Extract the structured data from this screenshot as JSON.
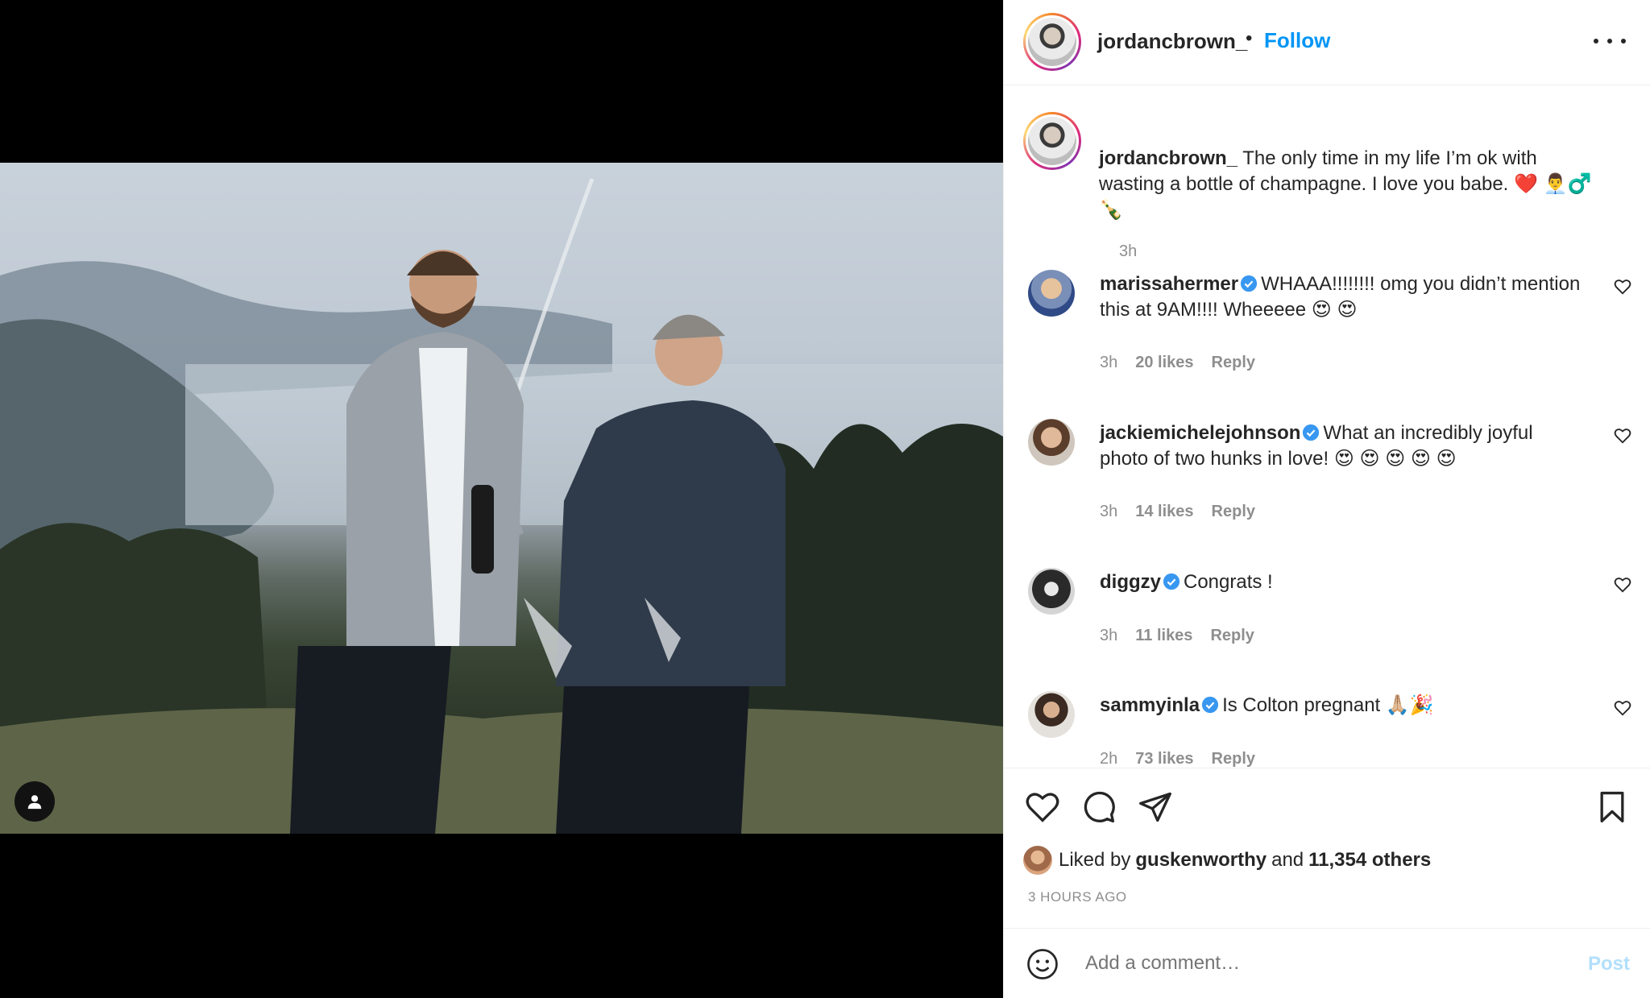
{
  "post": {
    "username": "jordancbrown_",
    "separator": "•",
    "follow_label": "Follow",
    "more_icon": "more-horizontal-icon"
  },
  "caption": {
    "username": "jordancbrown_",
    "text": "The only time in my life I’m ok with wasting a bottle of champagne. I love you babe. ❤️ 👨‍💼♂️ 🍾",
    "time": "3h"
  },
  "comments": [
    {
      "username": "marissahermer",
      "verified": true,
      "text": "WHAAA!!!!!!!! omg you didn’t mention this at 9AM!!!! Wheeeee 😍 😍",
      "time": "3h",
      "likes": "20 likes",
      "reply": "Reply"
    },
    {
      "username": "jackiemichelejohnson",
      "verified": true,
      "text": "What an incredibly joyful photo of two hunks in love! 😍 😍 😍 😍 😍",
      "time": "3h",
      "likes": "14 likes",
      "reply": "Reply"
    },
    {
      "username": "diggzy",
      "verified": true,
      "text": "Congrats !",
      "time": "3h",
      "likes": "11 likes",
      "reply": "Reply"
    },
    {
      "username": "sammyinla",
      "verified": true,
      "text": "Is Colton pregnant 🙏🏼🎉",
      "time": "2h",
      "likes": "73 likes",
      "reply": "Reply"
    }
  ],
  "likes": {
    "prefix": "Liked by",
    "user": "guskenworthy",
    "and": "and",
    "others": "11,354 others"
  },
  "timestamp": "3 HOURS AGO",
  "composer": {
    "placeholder": "Add a comment…",
    "post_label": "Post"
  },
  "colors": {
    "link_blue": "#0095f6",
    "post_disabled": "#b2dffc",
    "verified": "#3897f0",
    "muted": "#8e8e8e"
  }
}
